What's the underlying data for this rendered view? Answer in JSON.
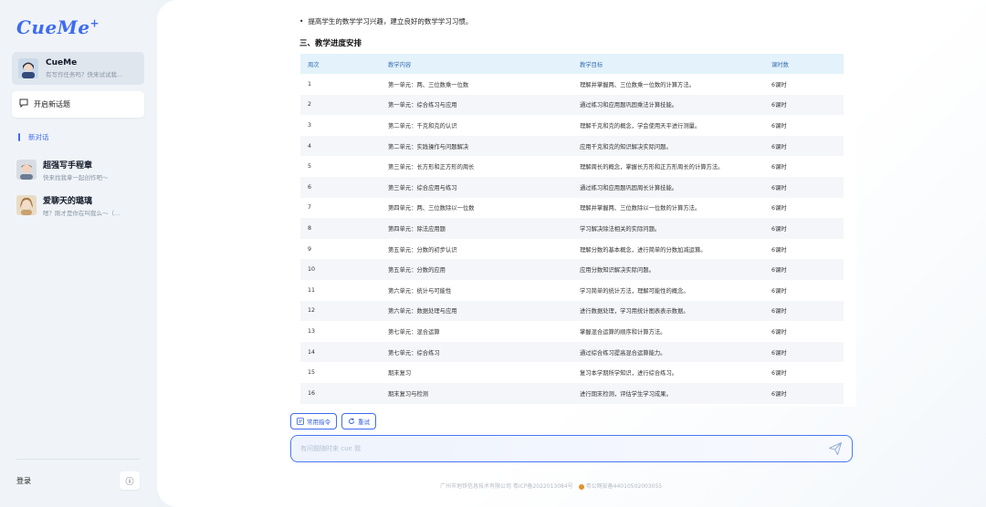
{
  "app": {
    "logo": "CueMe",
    "logo_plus": "+"
  },
  "sidebar": {
    "current_chat": {
      "title": "CueMe",
      "subtitle": "有写作任务吗？快来试试我..."
    },
    "new_topic": "开启新话题",
    "nav_new_chat": "新对话",
    "bots": [
      {
        "title": "超强写手程章",
        "subtitle": "快来找我拿一起创作吧～"
      },
      {
        "title": "爱聊天的璐璃",
        "subtitle": "嗯？刚才是你在叫我么～（..."
      }
    ],
    "login": "登录",
    "info_icon": "ⓘ"
  },
  "content": {
    "bullet": "提高学生的数学学习兴趣，建立良好的数学学习习惯。",
    "section_title": "三、教学进度安排",
    "table": {
      "headers": [
        "周次",
        "教学内容",
        "教学目标",
        "课时数"
      ],
      "rows": [
        [
          "1",
          "第一单元：两、三位数乘一位数",
          "理解并掌握两、三位数乘一位数的计算方法。",
          "6课时"
        ],
        [
          "2",
          "第一单元：综合练习与应用",
          "通过练习和应用题巩固乘法计算技能。",
          "6课时"
        ],
        [
          "3",
          "第二单元：千克和克的认识",
          "理解千克和克的概念，学会使用天平进行测量。",
          "6课时"
        ],
        [
          "4",
          "第二单元：实践操作与问题解决",
          "应用千克和克的知识解决实际问题。",
          "6课时"
        ],
        [
          "5",
          "第三单元：长方形和正方形的周长",
          "理解周长的概念，掌握长方形和正方形周长的计算方法。",
          "6课时"
        ],
        [
          "6",
          "第三单元：综合应用与练习",
          "通过练习和应用题巩固周长计算技能。",
          "6课时"
        ],
        [
          "7",
          "第四单元：两、三位数除以一位数",
          "理解并掌握两、三位数除以一位数的计算方法。",
          "6课时"
        ],
        [
          "8",
          "第四单元：除法应用题",
          "学习解决除法相关的实际问题。",
          "6课时"
        ],
        [
          "9",
          "第五单元：分数的初步认识",
          "理解分数的基本概念，进行简单的分数加减运算。",
          "6课时"
        ],
        [
          "10",
          "第五单元：分数的应用",
          "应用分数知识解决实际问题。",
          "6课时"
        ],
        [
          "11",
          "第六单元：统计与可能性",
          "学习简单的统计方法，理解可能性的概念。",
          "6课时"
        ],
        [
          "12",
          "第六单元：数据处理与应用",
          "进行数据处理，学习用统计图表表示数据。",
          "6课时"
        ],
        [
          "13",
          "第七单元：混合运算",
          "掌握混合运算的顺序和计算方法。",
          "6课时"
        ],
        [
          "14",
          "第七单元：综合练习",
          "通过综合练习提高混合运算能力。",
          "6课时"
        ],
        [
          "15",
          "期末复习",
          "复习本学期所学知识，进行综合练习。",
          "6课时"
        ],
        [
          "16",
          "期末复习与检测",
          "进行期末检测，评估学生学习成果。",
          "6课时"
        ]
      ]
    }
  },
  "actions": {
    "common_commands": "常用指令",
    "retry": "重试"
  },
  "input": {
    "placeholder": "有问题随时来 cue 我"
  },
  "footer": {
    "company": "广州市地铁信息技术有限公司 粤ICP备2022013084号",
    "police": "粤公网安备44010502003055"
  },
  "colors": {
    "accent": "#3e6bf0",
    "table_header_bg": "#e3f2fb",
    "table_header_text": "#3c6fb3"
  }
}
